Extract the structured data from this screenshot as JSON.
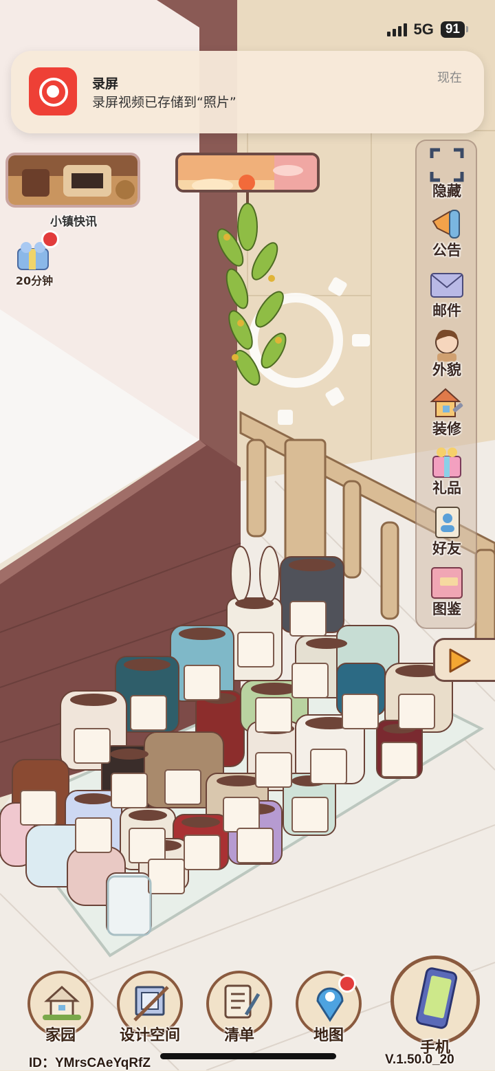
{
  "status_bar": {
    "network": "5G",
    "battery": "91"
  },
  "notification": {
    "app": "录屏",
    "message": "录屏视频已存储到“照片”",
    "time": "现在"
  },
  "left_widgets": {
    "news_label": "小镇快讯",
    "gift_timer": "20分钟"
  },
  "side_menu": [
    {
      "label": "隐藏",
      "icon": "hide-icon"
    },
    {
      "label": "公告",
      "icon": "megaphone-icon"
    },
    {
      "label": "邮件",
      "icon": "mail-icon"
    },
    {
      "label": "外貌",
      "icon": "avatar-icon"
    },
    {
      "label": "装修",
      "icon": "house-wrench-icon"
    },
    {
      "label": "礼品",
      "icon": "gift-icon"
    },
    {
      "label": "好友",
      "icon": "friends-icon"
    },
    {
      "label": "图鉴",
      "icon": "album-icon"
    }
  ],
  "bottom_nav": [
    {
      "label": "家园",
      "icon": "home-icon"
    },
    {
      "label": "设计空间",
      "icon": "design-icon"
    },
    {
      "label": "清单",
      "icon": "list-icon"
    },
    {
      "label": "地图",
      "icon": "map-pin-icon"
    },
    {
      "label": "手机",
      "icon": "phone-icon"
    }
  ],
  "footer": {
    "id_text": "ID：YMrsCAeYqRfZ",
    "version": "V.1.50.0_20"
  },
  "colors": {
    "accent_red": "#e23c3c",
    "frame_brown": "#8a5a3e"
  }
}
